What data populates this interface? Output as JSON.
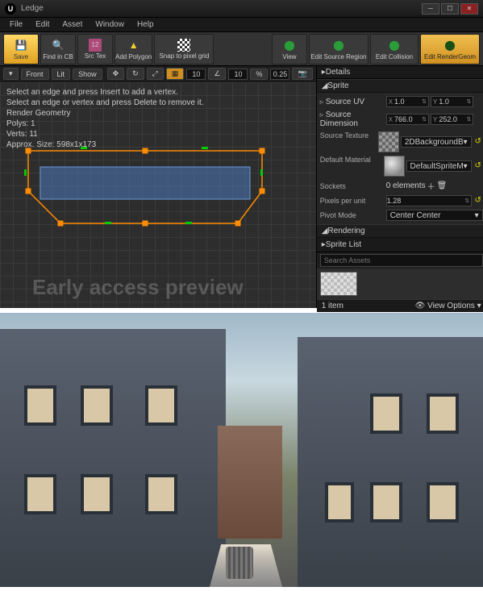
{
  "window": {
    "title": "Ledge"
  },
  "menu": [
    "File",
    "Edit",
    "Asset",
    "Window",
    "Help"
  ],
  "toolbar": {
    "save": "Save",
    "findInCB": "Find in CB",
    "srcTex": "Src Tex",
    "addPolygon": "Add Polygon",
    "snapToPixel": "Snap to pixel grid",
    "view": "View",
    "editSourceRegion": "Edit Source Region",
    "editCollision": "Edit Collision",
    "editRenderGeom": "Edit RenderGeom"
  },
  "viewport": {
    "btns": {
      "front": "Front",
      "lit": "Lit",
      "show": "Show"
    },
    "grid1": "10",
    "grid2": "10",
    "scale": "0.25",
    "help1": "Select an edge and press Insert to add a vertex.",
    "help2": "Select an edge or vertex and press Delete to remove it.",
    "renderGeom": "Render Geometry",
    "polys": "Polys: 1",
    "verts": "Verts: 11",
    "approx": "Approx. Size: 598x1x173",
    "watermark": "Early access preview"
  },
  "details": {
    "tab": "Details",
    "sprite": "Sprite",
    "sourceUV": "Source UV",
    "sourceUVx": "1.0",
    "sourceUVy": "1.0",
    "sourceDim": "Source Dimension",
    "sourceDimX": "766.0",
    "sourceDimY": "252.0",
    "sourceTex": "Source Texture",
    "sourceTexVal": "2DBackgroundB",
    "defaultMat": "Default Material",
    "defaultMatVal": "DefaultSpriteM",
    "sockets": "Sockets",
    "socketsVal": "0 elements",
    "ppu": "Pixels per unit",
    "ppuVal": "1.28",
    "pivot": "Pivot Mode",
    "pivotVal": "Center Center",
    "rendering": "Rendering"
  },
  "spriteList": {
    "tab": "Sprite List",
    "searchPlaceholder": "Search Assets",
    "count": "1 item",
    "viewOptions": "View Options"
  }
}
